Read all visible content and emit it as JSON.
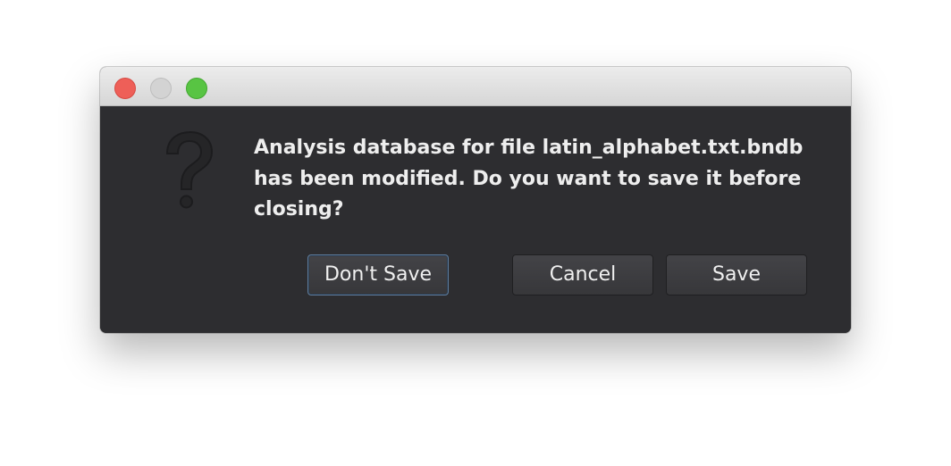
{
  "dialog": {
    "icon": "question-mark-icon",
    "message": "Analysis database for file latin_alphabet.txt.bndb\nhas been modified. Do you want to save it before\nclosing?",
    "buttons": {
      "dont_save": "Don't Save",
      "cancel": "Cancel",
      "save": "Save"
    }
  },
  "window_controls": {
    "close_color": "#ee5f58",
    "minimize_color": "#d3d3d3",
    "zoom_color": "#58c443"
  },
  "colors": {
    "dialog_background": "#2d2d30",
    "text": "#eeeeee",
    "focus_border": "#5f7d9d"
  }
}
